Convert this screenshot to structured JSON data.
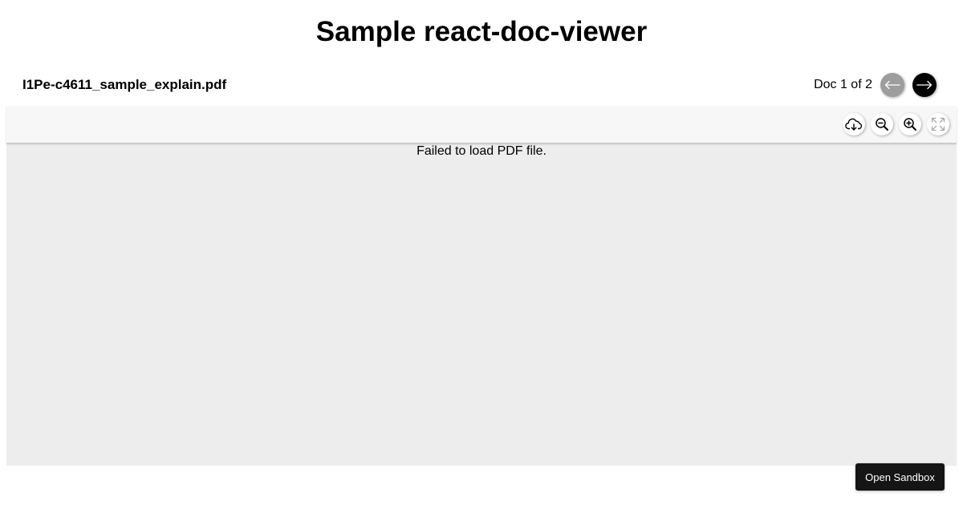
{
  "page": {
    "title": "Sample react-doc-viewer"
  },
  "header": {
    "file_name": "I1Pe-c4611_sample_explain.pdf",
    "doc_counter": "Doc 1 of 2",
    "prev_icon": "arrow-left-icon",
    "next_icon": "arrow-right-icon"
  },
  "toolbar": {
    "buttons": [
      {
        "icon": "cloud-download-icon"
      },
      {
        "icon": "zoom-out-icon"
      },
      {
        "icon": "zoom-in-icon"
      },
      {
        "icon": "fullscreen-icon"
      }
    ]
  },
  "viewer": {
    "error_message": "Failed to load PDF file."
  },
  "sandbox": {
    "label": "Open Sandbox"
  },
  "colors": {
    "viewer_background": "#ededed",
    "toolbar_background": "#f7f7f7",
    "prev_button_disabled": "#9d9d9d",
    "next_button": "#000000",
    "sandbox_button": "#151515"
  }
}
